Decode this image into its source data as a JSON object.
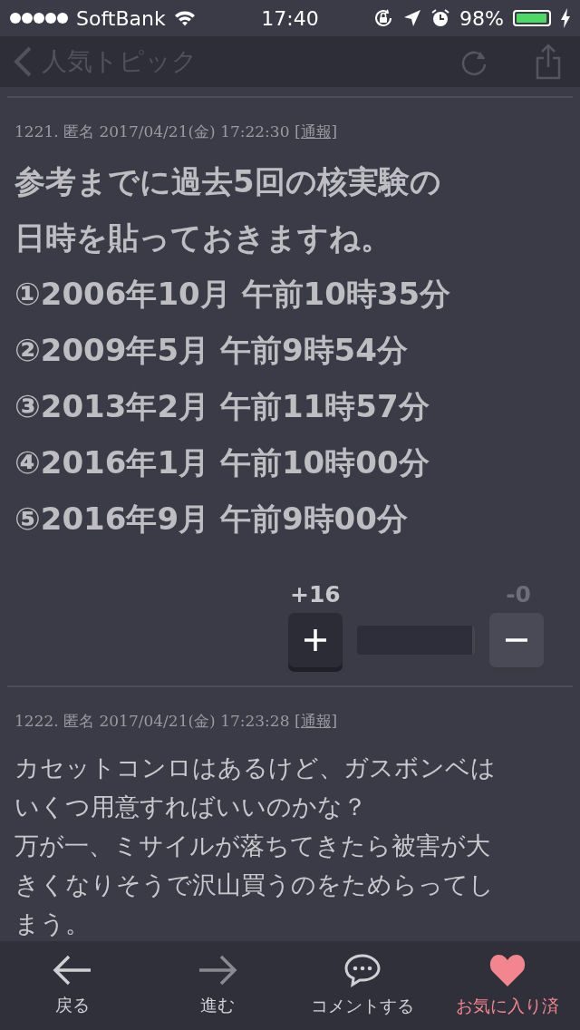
{
  "status_bar": {
    "carrier": "SoftBank",
    "time": "17:40",
    "battery": "98%"
  },
  "nav": {
    "back": "人気トピック"
  },
  "comments": [
    {
      "number": "1221.",
      "author": "匿名",
      "date": "2017/04/21(金) 17:22:30",
      "report": "[通報]",
      "large": true,
      "lines": [
        "参考までに過去5回の核実験の",
        "日時を貼っておきますね。",
        "①2006年10月 午前10時35分",
        "②2009年5月 午前9時54分",
        "③2013年2月 午前11時57分",
        "④2016年1月 午前10時00分",
        "⑤2016年9月 午前9時00分"
      ],
      "votes": {
        "plus": "+16",
        "minus": "-0",
        "level": 1
      }
    },
    {
      "number": "1222.",
      "author": "匿名",
      "date": "2017/04/21(金) 17:23:28",
      "report": "[通報]",
      "large": false,
      "lines": [
        "カセットコンロはあるけど、ガスボンベは",
        "いくつ用意すればいいのかな？",
        "万が一、ミサイルが落ちてきたら被害が大",
        "きくなりそうで沢山買うのをためらってし",
        "まう。"
      ]
    }
  ],
  "tab_bar": [
    {
      "kind": "back",
      "label": "戻る",
      "selected": false,
      "disabled": false
    },
    {
      "kind": "forward",
      "label": "進む",
      "selected": false,
      "disabled": true
    },
    {
      "kind": "comment",
      "label": "コメントする",
      "selected": false,
      "disabled": false
    },
    {
      "kind": "favorite",
      "label": "お気に入り済",
      "selected": true,
      "disabled": false
    }
  ]
}
